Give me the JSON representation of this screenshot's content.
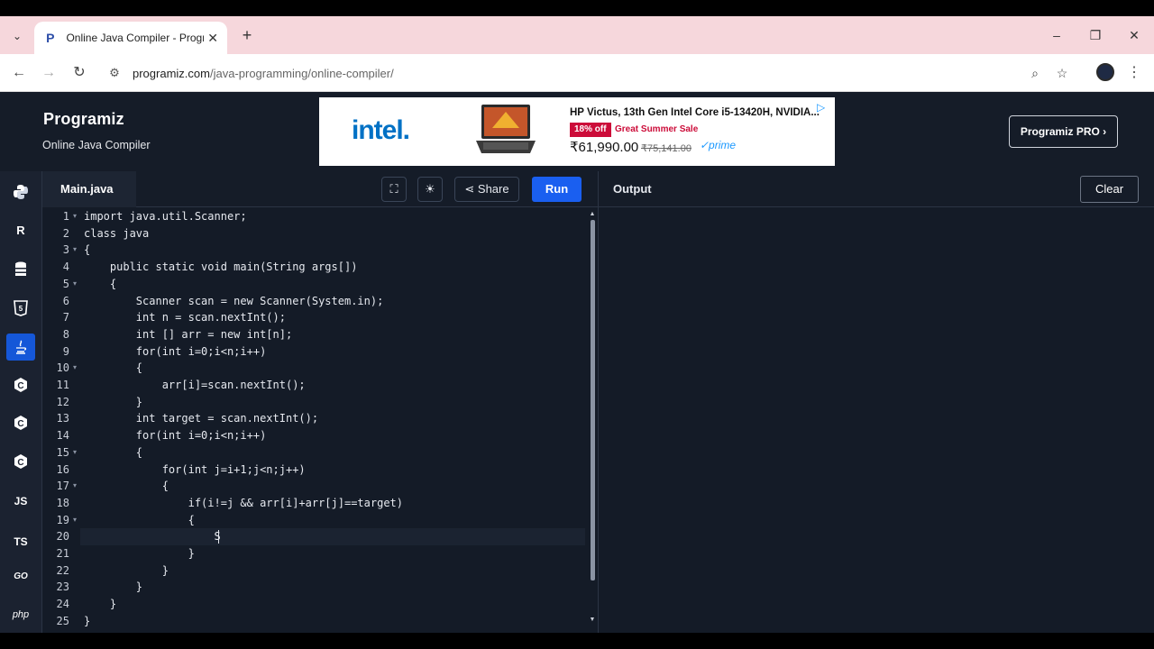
{
  "browser": {
    "tab_title": "Online Java Compiler - Programiz",
    "url_host": "programiz.com",
    "url_path": "/java-programming/online-compiler/"
  },
  "header": {
    "logo": "Programiz",
    "subtitle": "Online Java Compiler",
    "pro_button": "Programiz PRO ›"
  },
  "ad": {
    "brand": "intel.",
    "title": "HP Victus, 13th Gen Intel Core i5-13420H, NVIDIA...",
    "badge": "18% off",
    "sale": "Great Summer Sale",
    "price": "₹61,990.00",
    "mrp": "₹75,141.00",
    "prime": "✓prime"
  },
  "rail": [
    "python",
    "r",
    "sql",
    "html5",
    "java",
    "c",
    "cpp",
    "csharp",
    "JS",
    "TS",
    "GO",
    "php"
  ],
  "editor": {
    "file_tab": "Main.java",
    "share": "Share",
    "run": "Run",
    "lines": [
      {
        "n": "1",
        "code": "import java.util.Scanner;",
        "fold": true
      },
      {
        "n": "2",
        "code": "class java",
        "fold": false
      },
      {
        "n": "3",
        "code": "{",
        "fold": true
      },
      {
        "n": "4",
        "code": "    public static void main(String args[])",
        "fold": false
      },
      {
        "n": "5",
        "code": "    {",
        "fold": true
      },
      {
        "n": "6",
        "code": "        Scanner scan = new Scanner(System.in);",
        "fold": false
      },
      {
        "n": "7",
        "code": "        int n = scan.nextInt();",
        "fold": false
      },
      {
        "n": "8",
        "code": "        int [] arr = new int[n];",
        "fold": false
      },
      {
        "n": "9",
        "code": "        for(int i=0;i<n;i++)",
        "fold": false
      },
      {
        "n": "10",
        "code": "        {",
        "fold": true
      },
      {
        "n": "11",
        "code": "            arr[i]=scan.nextInt();",
        "fold": false
      },
      {
        "n": "12",
        "code": "        }",
        "fold": false
      },
      {
        "n": "13",
        "code": "        int target = scan.nextInt();",
        "fold": false
      },
      {
        "n": "14",
        "code": "        for(int i=0;i<n;i++)",
        "fold": false
      },
      {
        "n": "15",
        "code": "        {",
        "fold": true
      },
      {
        "n": "16",
        "code": "            for(int j=i+1;j<n;j++)",
        "fold": false
      },
      {
        "n": "17",
        "code": "            {",
        "fold": true
      },
      {
        "n": "18",
        "code": "                if(i!=j && arr[i]+arr[j]==target)",
        "fold": false
      },
      {
        "n": "19",
        "code": "                {",
        "fold": true
      },
      {
        "n": "20",
        "code": "                    S",
        "fold": false
      },
      {
        "n": "21",
        "code": "                }",
        "fold": false
      },
      {
        "n": "22",
        "code": "            }",
        "fold": false
      },
      {
        "n": "23",
        "code": "        }",
        "fold": false
      },
      {
        "n": "24",
        "code": "    }",
        "fold": false
      },
      {
        "n": "25",
        "code": "}",
        "fold": false
      }
    ]
  },
  "output": {
    "title": "Output",
    "clear": "Clear"
  }
}
